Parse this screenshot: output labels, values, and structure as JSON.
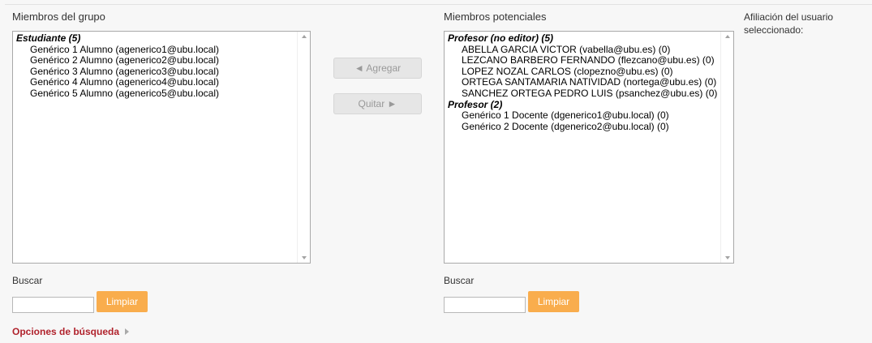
{
  "group_members": {
    "label": "Miembros del grupo",
    "groups": [
      {
        "name": "Estudiante (5)",
        "items": [
          "Genérico 1 Alumno (agenerico1@ubu.local)",
          "Genérico 2 Alumno (agenerico2@ubu.local)",
          "Genérico 3 Alumno (agenerico3@ubu.local)",
          "Genérico 4 Alumno (agenerico4@ubu.local)",
          "Genérico 5 Alumno (agenerico5@ubu.local)"
        ]
      }
    ],
    "search_label": "Buscar",
    "search_value": "",
    "clear_label": "Limpiar"
  },
  "actions": {
    "add_label": "◄ Agregar",
    "remove_label": "Quitar ►"
  },
  "potential_members": {
    "label": "Miembros potenciales",
    "groups": [
      {
        "name": "Profesor (no editor) (5)",
        "items": [
          "ABELLA GARCIA VICTOR (vabella@ubu.es) (0)",
          "LEZCANO BARBERO FERNANDO (flezcano@ubu.es) (0)",
          "LOPEZ NOZAL CARLOS (clopezno@ubu.es) (0)",
          "ORTEGA SANTAMARIA NATIVIDAD (nortega@ubu.es) (0)",
          "SANCHEZ ORTEGA PEDRO LUIS (psanchez@ubu.es) (0)"
        ]
      },
      {
        "name": "Profesor (2)",
        "items": [
          "Genérico 1 Docente (dgenerico1@ubu.local) (0)",
          "Genérico 2 Docente (dgenerico2@ubu.local) (0)"
        ]
      }
    ],
    "search_label": "Buscar",
    "search_value": "",
    "clear_label": "Limpiar"
  },
  "user_affiliation": {
    "label": "Afiliación del usuario seleccionado:"
  },
  "search_options": {
    "label": "Opciones de búsqueda"
  },
  "colors": {
    "clear_button": "#f9ad4d",
    "link": "#b0222c",
    "disabled_button": "#e6e6e6"
  }
}
